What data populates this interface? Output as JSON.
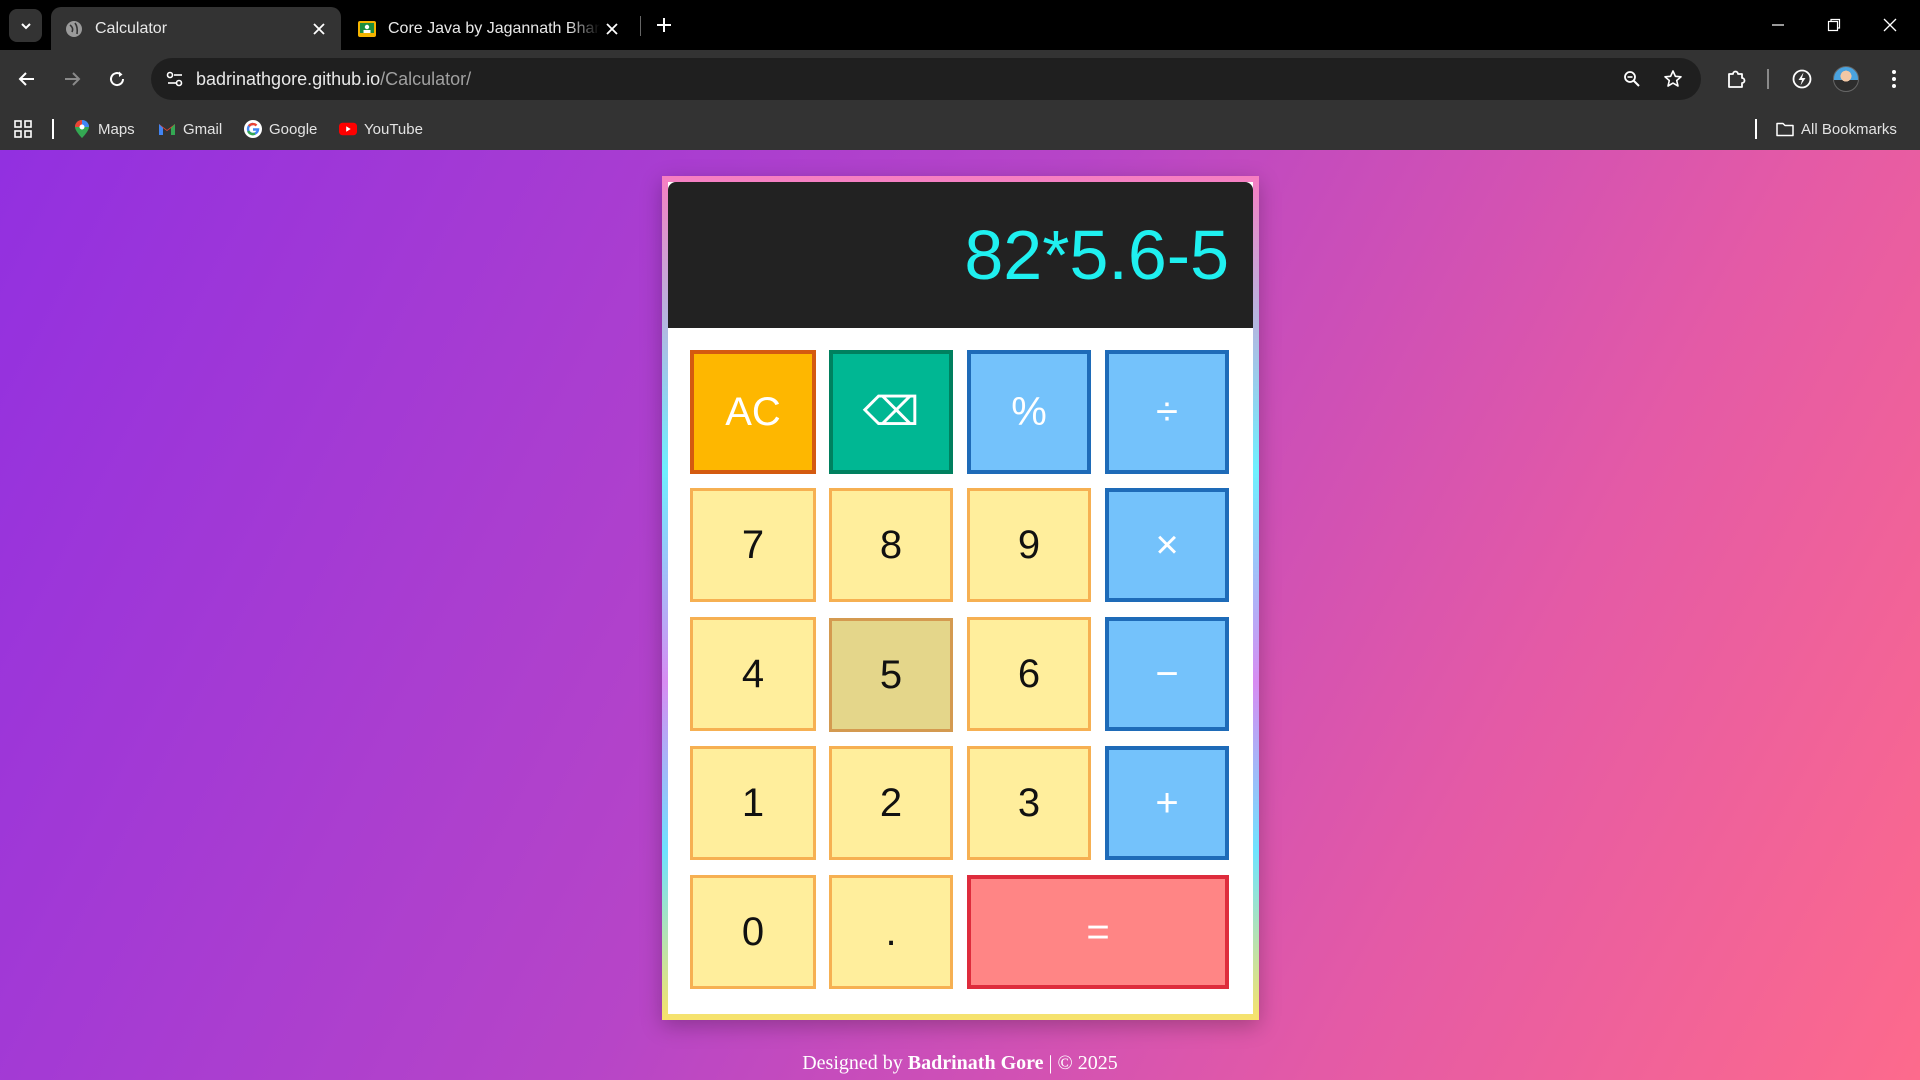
{
  "browser": {
    "tabs": [
      {
        "title": "Calculator",
        "active": true,
        "icon": "globe-icon"
      },
      {
        "title": "Core Java by Jagannath Bhandari",
        "active": false,
        "icon": "classroom-icon"
      }
    ],
    "url": {
      "host": "badrinathgore.github.io",
      "path": "/Calculator/"
    },
    "bookmarks": [
      {
        "label": "Maps",
        "icon": "maps-icon"
      },
      {
        "label": "Gmail",
        "icon": "gmail-icon"
      },
      {
        "label": "Google",
        "icon": "google-icon"
      },
      {
        "label": "YouTube",
        "icon": "youtube-icon"
      }
    ],
    "all_bookmarks_label": "All Bookmarks"
  },
  "calculator": {
    "display": "82*5.6-5",
    "keys": {
      "ac": "AC",
      "backspace": "⌫",
      "percent": "%",
      "divide": "÷",
      "seven": "7",
      "eight": "8",
      "nine": "9",
      "multiply": "×",
      "four": "4",
      "five": "5",
      "six": "6",
      "minus": "−",
      "one": "1",
      "two": "2",
      "three": "3",
      "plus": "+",
      "zero": "0",
      "dot": ".",
      "equals": "="
    },
    "pressed_key": "5"
  },
  "footer": {
    "prefix": "Designed by",
    "author": "Badrinath Gore",
    "suffix": "| © 2025"
  },
  "colors": {
    "display_text": "#1ff0f0",
    "number_key": "#ffee9c",
    "operator_key": "#74c2fb",
    "ac_key": "#feb700",
    "backspace_key": "#00b793",
    "equals_key": "#ff8585"
  }
}
